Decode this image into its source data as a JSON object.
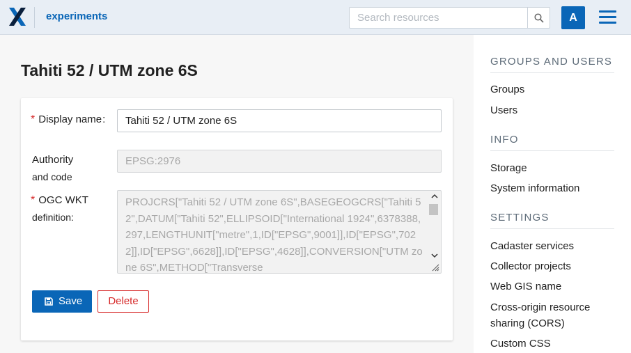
{
  "header": {
    "app_name": "experiments",
    "search_placeholder": "Search resources",
    "avatar_letter": "A",
    "brand_color": "#0a66b7"
  },
  "page": {
    "title": "Tahiti 52 / UTM zone 6S"
  },
  "form": {
    "display_name_label": "Display name",
    "display_name_colon": ":",
    "display_name_value": "Tahiti 52 / UTM zone 6S",
    "authority_label_1": "Authority",
    "authority_label_2": "and code",
    "authority_value": "EPSG:2976",
    "wkt_label_1": "OGC WKT",
    "wkt_label_2": "definition:",
    "wkt_value": "PROJCRS[\"Tahiti 52 / UTM zone 6S\",BASEGEOGCRS[\"Tahiti 52\",DATUM[\"Tahiti 52\",ELLIPSOID[\"International 1924\",6378388,297,LENGTHUNIT[\"metre\",1,ID[\"EPSG\",9001]],ID[\"EPSG\",7022]],ID[\"EPSG\",6628]],ID[\"EPSG\",4628]],CONVERSION[\"UTM zone 6S\",METHOD[\"Transverse",
    "required_mark": "*",
    "save_label": "Save",
    "delete_label": "Delete"
  },
  "sidebar": {
    "sections": [
      {
        "heading": "GROUPS AND USERS",
        "items": [
          "Groups",
          "Users"
        ]
      },
      {
        "heading": "INFO",
        "items": [
          "Storage",
          "System information"
        ]
      },
      {
        "heading": "SETTINGS",
        "items": [
          "Cadaster services",
          "Collector projects",
          "Web GIS name",
          "Cross-origin resource",
          "sharing (CORS)",
          "Custom CSS"
        ]
      }
    ]
  },
  "colors": {
    "accent": "#0a66b7",
    "danger": "#d62828",
    "header_bg": "#e8eef5"
  }
}
